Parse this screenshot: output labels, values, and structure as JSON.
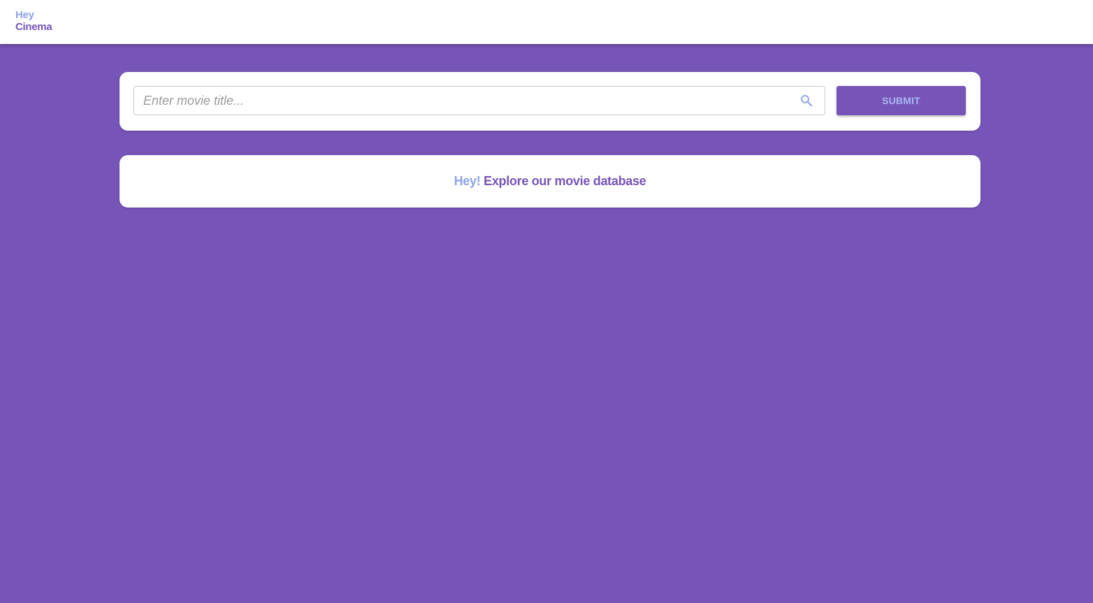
{
  "header": {
    "logo_hey": "Hey",
    "logo_cinema": "Cinema"
  },
  "search": {
    "placeholder": "Enter movie title...",
    "value": "",
    "icon": "search-icon",
    "submit_label": "SUBMIT"
  },
  "welcome": {
    "hey": "Hey!",
    "message": "Explore our movie database"
  },
  "colors": {
    "background": "#7754b8",
    "accent_light": "#8da2e8",
    "accent": "#7754b8",
    "button_text": "#aab8f2",
    "card": "#ffffff"
  }
}
